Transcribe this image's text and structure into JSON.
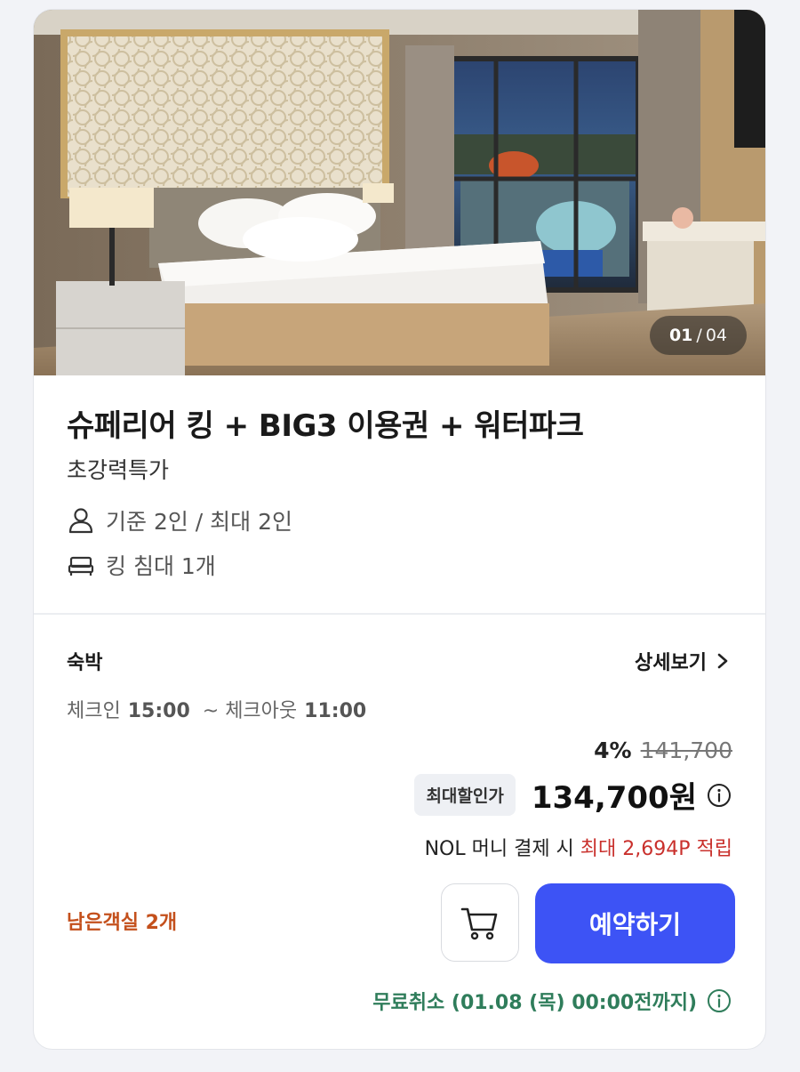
{
  "gallery": {
    "current": "01",
    "separator": "/",
    "total": "04",
    "image_alt": "hotel-room-photo"
  },
  "room": {
    "title": "슈페리어 킹 + BIG3 이용권 + 워터파크",
    "subtitle": "초강력특가",
    "occupancy": "기준 2인 / 최대 2인",
    "bed": "킹 침대 1개"
  },
  "stay": {
    "label": "숙박",
    "details_link": "상세보기",
    "checkin_label": "체크인",
    "checkin_time": "15:00",
    "checkout_label": "~ 체크아웃",
    "checkout_time": "11:00"
  },
  "pricing": {
    "discount_percent": "4%",
    "original_price": "141,700",
    "badge": "최대할인가",
    "final_price": "134,700원",
    "points_prefix": "NOL 머니 결제 시 ",
    "points_highlight": "최대 2,694P 적립"
  },
  "availability": {
    "remaining": "남은객실 2개"
  },
  "actions": {
    "book_label": "예약하기"
  },
  "cancellation": {
    "text": "무료취소 (01.08 (목) 00:00전까지)"
  },
  "colors": {
    "accent": "#3d53f5",
    "remaining": "#c4501c",
    "points_highlight": "#c9302c",
    "cancellation": "#2f7d5b"
  },
  "icons": [
    "person-icon",
    "bed-icon",
    "chevron-right-icon",
    "info-icon",
    "cart-icon"
  ]
}
